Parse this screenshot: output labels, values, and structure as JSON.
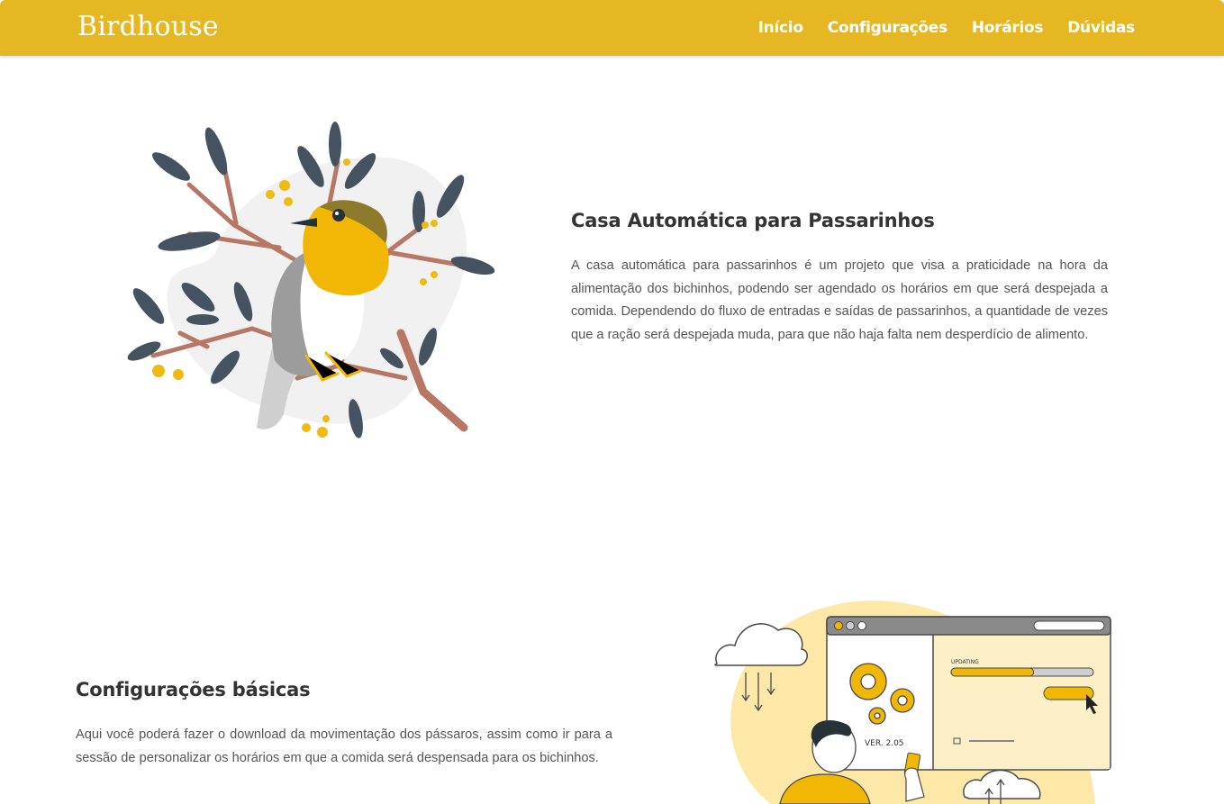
{
  "brand": {
    "logo": "Birdhouse",
    "color": "#e5b823"
  },
  "nav": {
    "items": [
      {
        "label": "Início"
      },
      {
        "label": "Configurações"
      },
      {
        "label": "Horários"
      },
      {
        "label": "Dúvidas"
      }
    ]
  },
  "hero": {
    "title": "Casa Automática para Passarinhos",
    "body": "A casa automática para passarinhos é um projeto que visa a praticidade na hora da alimentação dos bichinhos, podendo ser agendado os horários em que será despejada a comida. Dependendo do fluxo de entradas e saídas de passarinhos, a quantidade de vezes que a ração será despejada muda, para que não haja falta nem desperdício de alimento.",
    "illustration": "bird-on-branch-illustration"
  },
  "config": {
    "title": "Configurações básicas",
    "body": "Aqui você poderá fazer o download da movimentação dos pássaros, assim como ir para a sessão de personalizar os horários em que a comida será despensada para os bichinhos.",
    "illustration": {
      "name": "software-update-illustration",
      "updating_label": "UPDATING",
      "version_label": "VER. 2.05",
      "progress": 0.58
    }
  }
}
